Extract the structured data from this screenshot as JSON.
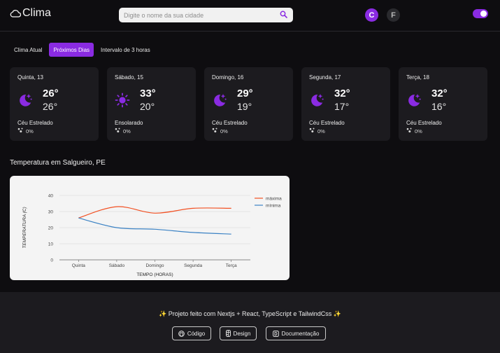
{
  "header": {
    "app_name": "Clima",
    "search_placeholder": "Digite o nome da sua cidade",
    "unit_celsius": "C",
    "unit_fahrenheit": "F",
    "accent_color": "#8a2be2"
  },
  "tabs": [
    {
      "label": "Clima Atual",
      "active": false
    },
    {
      "label": "Próximos Dias",
      "active": true
    },
    {
      "label": "Intervalo de 3 horas",
      "active": false
    }
  ],
  "cards": [
    {
      "day": "Quinta, 13",
      "max": "26°",
      "min": "26°",
      "condition": "Céu Estrelado",
      "rain": "0%",
      "icon": "moon-stars-icon"
    },
    {
      "day": "Sábado, 15",
      "max": "33°",
      "min": "20°",
      "condition": "Ensolarado",
      "rain": "0%",
      "icon": "sun-icon"
    },
    {
      "day": "Domingo, 16",
      "max": "29°",
      "min": "19°",
      "condition": "Céu Estrelado",
      "rain": "0%",
      "icon": "moon-stars-icon"
    },
    {
      "day": "Segunda, 17",
      "max": "32°",
      "min": "17°",
      "condition": "Céu Estrelado",
      "rain": "0%",
      "icon": "moon-stars-icon"
    },
    {
      "day": "Terça, 18",
      "max": "32°",
      "min": "16°",
      "condition": "Céu Estrelado",
      "rain": "0%",
      "icon": "moon-stars-icon"
    }
  ],
  "chart_section": {
    "title": "Temperatura em Salgueiro, PE"
  },
  "chart_data": {
    "type": "line",
    "categories": [
      "Quinta",
      "Sábado",
      "Domingo",
      "Segunda",
      "Terça"
    ],
    "series": [
      {
        "name": "máxima",
        "values": [
          26,
          33,
          29,
          32,
          32
        ],
        "color": "#f25022"
      },
      {
        "name": "mínima",
        "values": [
          26,
          20,
          19,
          17,
          16
        ],
        "color": "#3b82c4"
      }
    ],
    "xlabel": "TEMPO (HORAS)",
    "ylabel": "TEMPERATURA (C)",
    "ylim": [
      0,
      40
    ],
    "yticks": [
      0,
      10,
      20,
      30,
      40
    ],
    "grid": true,
    "legend": "right"
  },
  "footer": {
    "credit": "✨ Projeto feito com Nextjs + React, TypeScript e TailwindCss ✨",
    "buttons": [
      {
        "label": "Código",
        "icon": "github-icon"
      },
      {
        "label": "Design",
        "icon": "figma-icon"
      },
      {
        "label": "Documentação",
        "icon": "doc-icon"
      }
    ]
  }
}
